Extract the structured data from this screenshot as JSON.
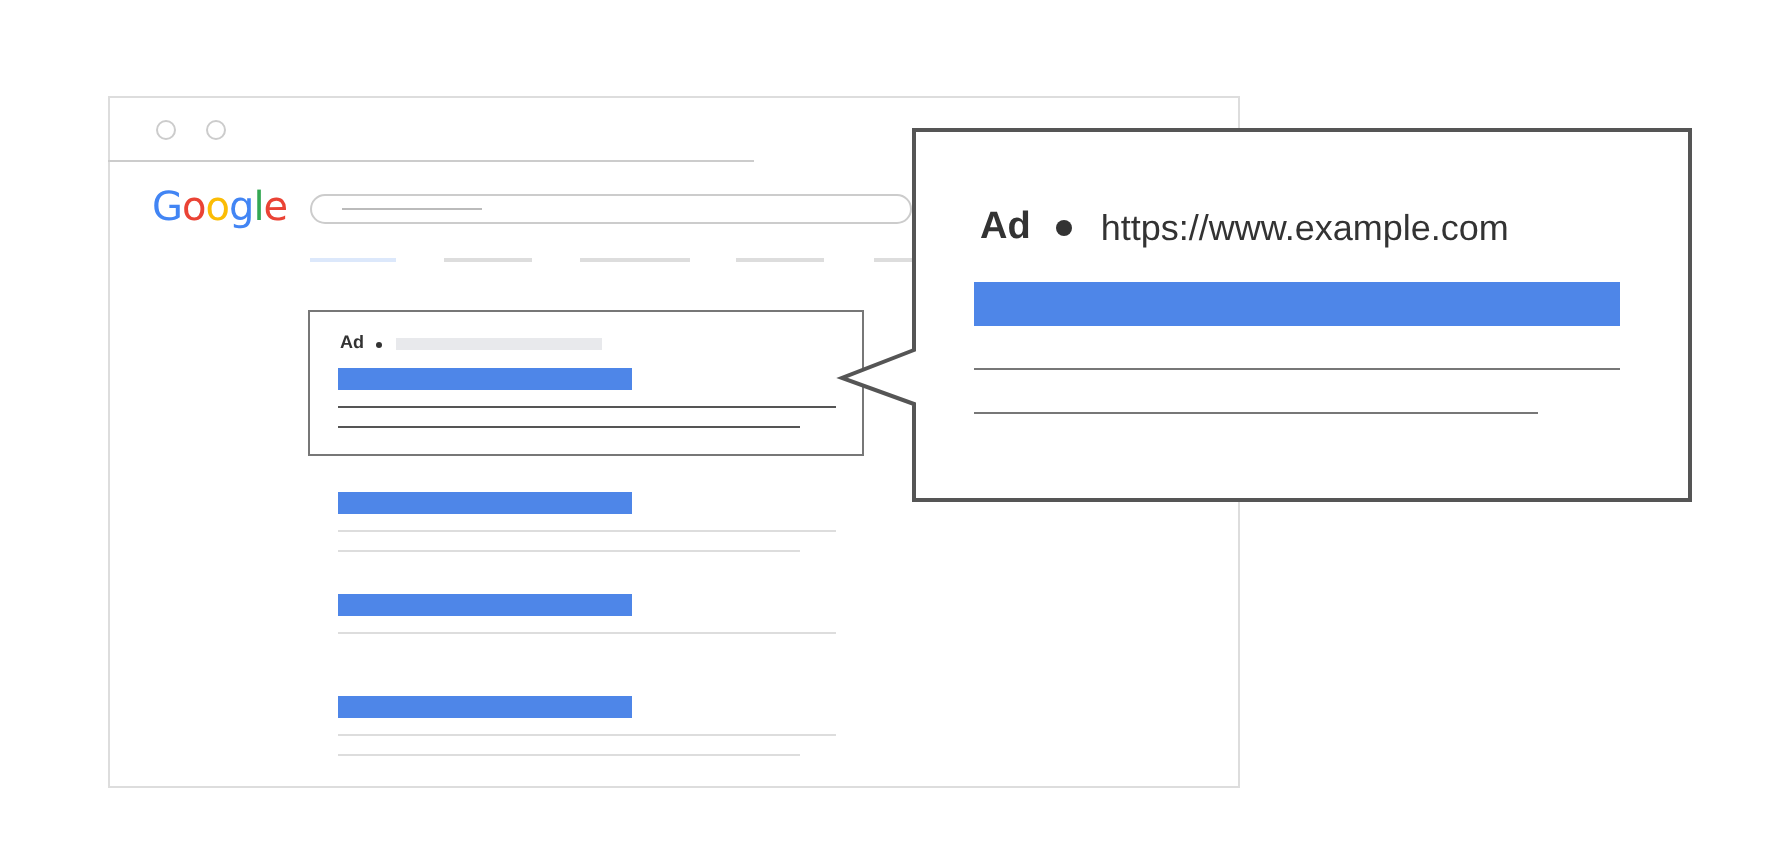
{
  "browser": {
    "logo": [
      {
        "text": "G",
        "color": "#4285f4"
      },
      {
        "text": "o",
        "color": "#ea4335"
      },
      {
        "text": "o",
        "color": "#fbbc05"
      },
      {
        "text": "g",
        "color": "#4285f4"
      },
      {
        "text": "l",
        "color": "#34a853"
      },
      {
        "text": "e",
        "color": "#ea4335"
      }
    ],
    "tabs": [
      {
        "selected": true
      },
      {
        "selected": false
      },
      {
        "selected": false
      },
      {
        "selected": false
      },
      {
        "selected": false
      }
    ],
    "results": [
      {
        "kind": "ad",
        "label": "Ad",
        "lines": [
          {
            "kind": "long"
          },
          {
            "kind": "short"
          }
        ]
      },
      {
        "kind": "organic",
        "lines": [
          {
            "kind": "long"
          },
          {
            "kind": "short"
          }
        ]
      },
      {
        "kind": "organic",
        "lines": [
          {
            "kind": "long"
          }
        ]
      },
      {
        "kind": "organic",
        "lines": [
          {
            "kind": "long"
          },
          {
            "kind": "short"
          }
        ]
      }
    ]
  },
  "callout": {
    "label": "Ad",
    "url": "https://www.example.com",
    "lines": [
      {
        "kind": "long"
      },
      {
        "kind": "short"
      }
    ]
  }
}
